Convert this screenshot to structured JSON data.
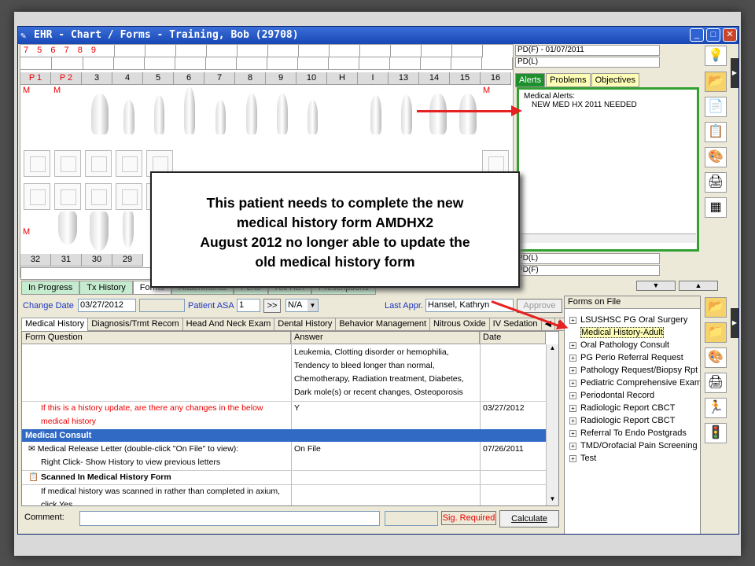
{
  "window": {
    "title": "EHR - Chart / Forms - Training, Bob (29708)"
  },
  "chart": {
    "top_row": [
      "7",
      "5",
      "6",
      "7",
      "8",
      "9",
      "",
      "",
      "",
      "",
      "",
      "",
      "",
      "",
      "",
      ""
    ],
    "upper_numbers": [
      "P 1",
      "P 2",
      "3",
      "4",
      "5",
      "6",
      "7",
      "8",
      "9",
      "10",
      "H",
      "I",
      "13",
      "14",
      "15",
      "16"
    ],
    "lower_numbers": [
      "32",
      "31",
      "30",
      "29"
    ],
    "marks": {
      "m1": "M",
      "m2": "M",
      "m3": "M",
      "m4": "M"
    }
  },
  "pd": {
    "row1": "PD(F) - 01/07/2011",
    "row2": "PD(L)",
    "row3": "PD(L)",
    "row4": "PD(F)"
  },
  "alert_tabs": [
    "Alerts",
    "Problems",
    "Objectives"
  ],
  "alerts": {
    "heading": "Medical Alerts:",
    "item": "NEW MED HX 2011 NEEDED"
  },
  "callout": {
    "line1": "This patient needs to complete the  new",
    "line2": "medical history form AMDHX2",
    "line3": "August 2012 no longer able to update the",
    "line4": "old medical history form"
  },
  "bottom_tabs": [
    "In Progress",
    "Tx History",
    "Forms",
    "Attachments",
    "Perio",
    "Rx/Tlcn",
    "Prescriptions"
  ],
  "controls": {
    "change_date_label": "Change Date",
    "change_date_value": "03/27/2012",
    "asa_label": "Patient ASA",
    "asa_value": "1",
    "asa_btn": ">>",
    "na_value": "N/A",
    "last_appr_label": "Last Appr.",
    "last_appr_value": "Hansel, Kathryn",
    "approve": "Approve"
  },
  "form_tabs": [
    "Medical History",
    "Diagnosis/Trmt Recom",
    "Head And Neck Exam",
    "Dental History",
    "Behavior Management",
    "Nitrous Oxide",
    "IV Sedation"
  ],
  "grid": {
    "headers": {
      "q": "Form Question",
      "a": "Answer",
      "d": "Date"
    },
    "r1_answer": [
      "Leukemia, Clotting disorder or hemophilia,",
      "Tendency to bleed longer than normal,",
      "Chemotherapy, Radiation treatment, Diabetes,",
      "Dark mole(s) or recent changes, Osteoporosis"
    ],
    "r2_q": [
      "If this is a history update, are there any changes in the below",
      "medical history"
    ],
    "r2_a": "Y",
    "r2_d": "03/27/2012",
    "section": "Medical Consult",
    "r3_q": [
      "Medical Release Letter (double-click \"On File\" to view):",
      "Right Click- Show History to view previous letters"
    ],
    "r3_a": "On File",
    "r3_d": "07/26/2011",
    "r4_q": "Scanned In Medical History Form",
    "r5_q": [
      "If medical history was scanned in rather than completed in axium,",
      "click Yes"
    ]
  },
  "comment": {
    "label": "Comment:",
    "sig": "Sig. Required",
    "calc": "Calculate"
  },
  "forms_on_file": {
    "title": "Forms on File",
    "items": [
      "LSUSHSC PG Oral Surgery",
      "Medical History-Adult",
      "Oral Pathology Consult",
      "PG Perio Referral Request",
      "Pathology Request/Biopsy Rpt",
      "Pediatric Comprehensive Exam",
      "Periodontal Record",
      "Radiologic Report CBCT",
      "Radiologic Report CBCT",
      "Referral To Endo Postgrads",
      "TMD/Orofacial Pain Screening",
      "Test"
    ]
  },
  "colors": {
    "title_bar": "#1747b5",
    "alert_border": "#32a032",
    "arrow": "#e52222",
    "selected_row": "#316ac5"
  }
}
